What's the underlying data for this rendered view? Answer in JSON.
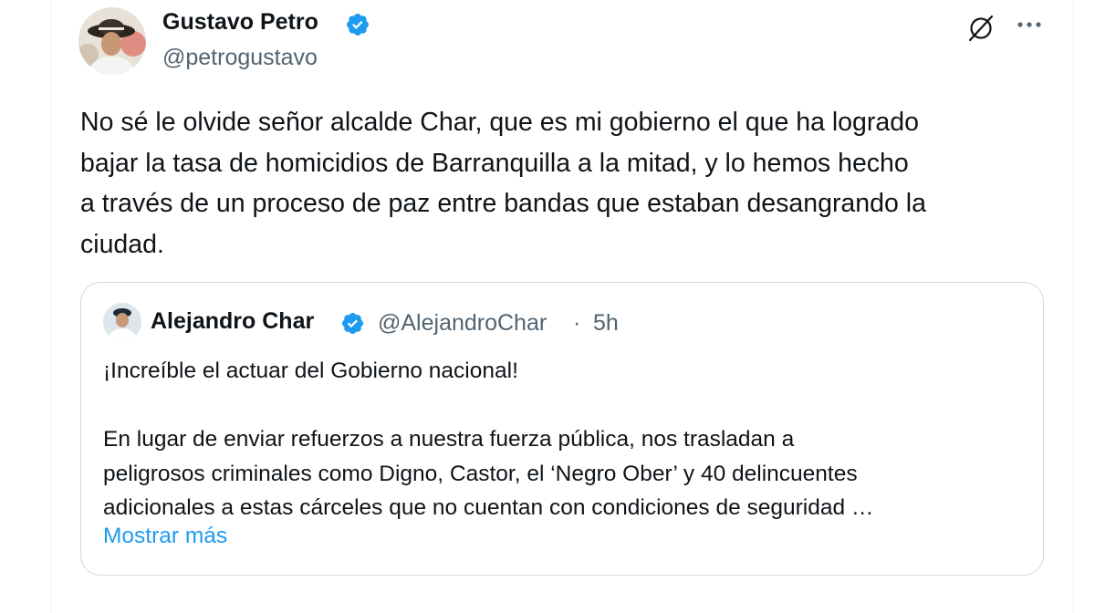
{
  "post": {
    "author": {
      "name": "Gustavo Petro",
      "handle": "@petrogustavo",
      "verified": true,
      "avatar": "avatar-photo"
    },
    "actions": {
      "grok_icon": "grok-icon",
      "more_icon": "more-icon"
    },
    "text": "No sé le olvide señor alcalde Char, que es mi gobierno el que ha logrado\nbajar la tasa de homicidios de Barranquilla a la mitad, y lo hemos hecho\na través de un proceso de paz entre bandas que estaban desangrando la\nciudad."
  },
  "quote": {
    "author": {
      "name": "Alejandro Char",
      "handle": "@AlejandroChar",
      "verified": true,
      "avatar": "avatar-photo"
    },
    "separator": "·",
    "time": "5h",
    "text": "¡Increíble el actuar del Gobierno nacional!\n\nEn lugar de enviar refuerzos a nuestra fuerza pública, nos trasladan a\npeligrosos criminales como Digno, Castor, el ‘Negro Ober’ y 40 delincuentes\nadicionales a estas cárceles que no cuentan con condiciones de seguridad …",
    "show_more": "Mostrar más"
  },
  "colors": {
    "text_primary": "#0f1419",
    "text_secondary": "#536471",
    "link": "#1d9bf0",
    "verified": "#1d9bf0",
    "border": "#cfd9de"
  }
}
